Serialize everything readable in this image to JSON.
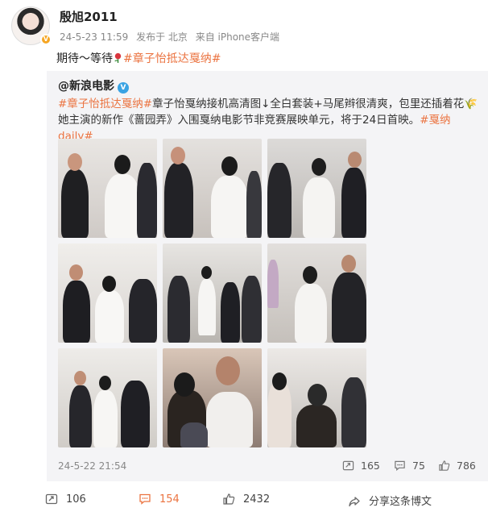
{
  "post": {
    "username": "殷旭2011",
    "time": "24-5-23 11:59",
    "posted_from": "发布于 北京",
    "client": "来自 iPhone客户端",
    "text_prefix": "期待～等待",
    "hashtag": "#章子怡抵达戛纳#"
  },
  "repost": {
    "username": "@新浪电影",
    "hashtag1": "#章子怡抵达戛纳#",
    "body": "章子怡戛纳接机高清图↓全白套装+马尾辫很清爽，包里还插着花🌾她主演的新作《蔷园弄》入围戛纳电影节非竞赛展映单元，将于24日首映。",
    "hashtag2": "#戛纳daily#",
    "time": "24-5-22 21:54",
    "share_count": "165",
    "comment_count": "75",
    "like_count": "786"
  },
  "footer": {
    "share_count": "106",
    "comment_count": "154",
    "like_count": "2432",
    "share_label": "分享这条博文"
  },
  "colors": {
    "hashtag": "#eb7340",
    "vip_badge": "#f6a623",
    "verified_blue": "#3aa3e3",
    "repost_bg": "#f4f4f6"
  }
}
